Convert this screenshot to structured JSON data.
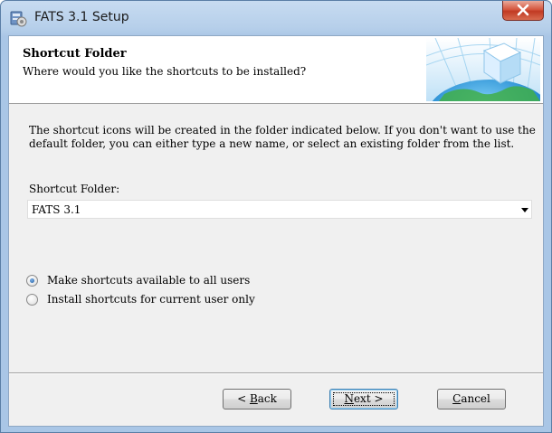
{
  "window": {
    "title": "FATS 3.1 Setup",
    "icons": {
      "app": "setup-package-icon",
      "close": "close-icon"
    }
  },
  "header": {
    "title": "Shortcut Folder",
    "subtitle": "Where would you like the shortcuts to be installed?",
    "graphic": "globe-cube-icon"
  },
  "description": "The shortcut icons will be created in the folder indicated below. If you don't want to use the default folder, you can either type a new name, or select an existing folder from the list.",
  "folder": {
    "label": "Shortcut Folder:",
    "value": "FATS 3.1",
    "dropdown_icon": "chevron-down-icon"
  },
  "options": [
    {
      "label": "Make shortcuts available to all users",
      "checked": true
    },
    {
      "label": "Install shortcuts for current user only",
      "checked": false
    }
  ],
  "buttons": {
    "back": {
      "prefix": "< ",
      "mnemonic": "B",
      "rest": "ack"
    },
    "next": {
      "mnemonic": "N",
      "rest": "ext",
      "suffix": " >"
    },
    "cancel": {
      "mnemonic": "C",
      "rest": "ancel"
    }
  },
  "colors": {
    "title_bar": "#b6cfea",
    "close_button": "#c13a23",
    "dialog_background": "#f0f0f0",
    "default_button_border": "#3c7fb1"
  }
}
